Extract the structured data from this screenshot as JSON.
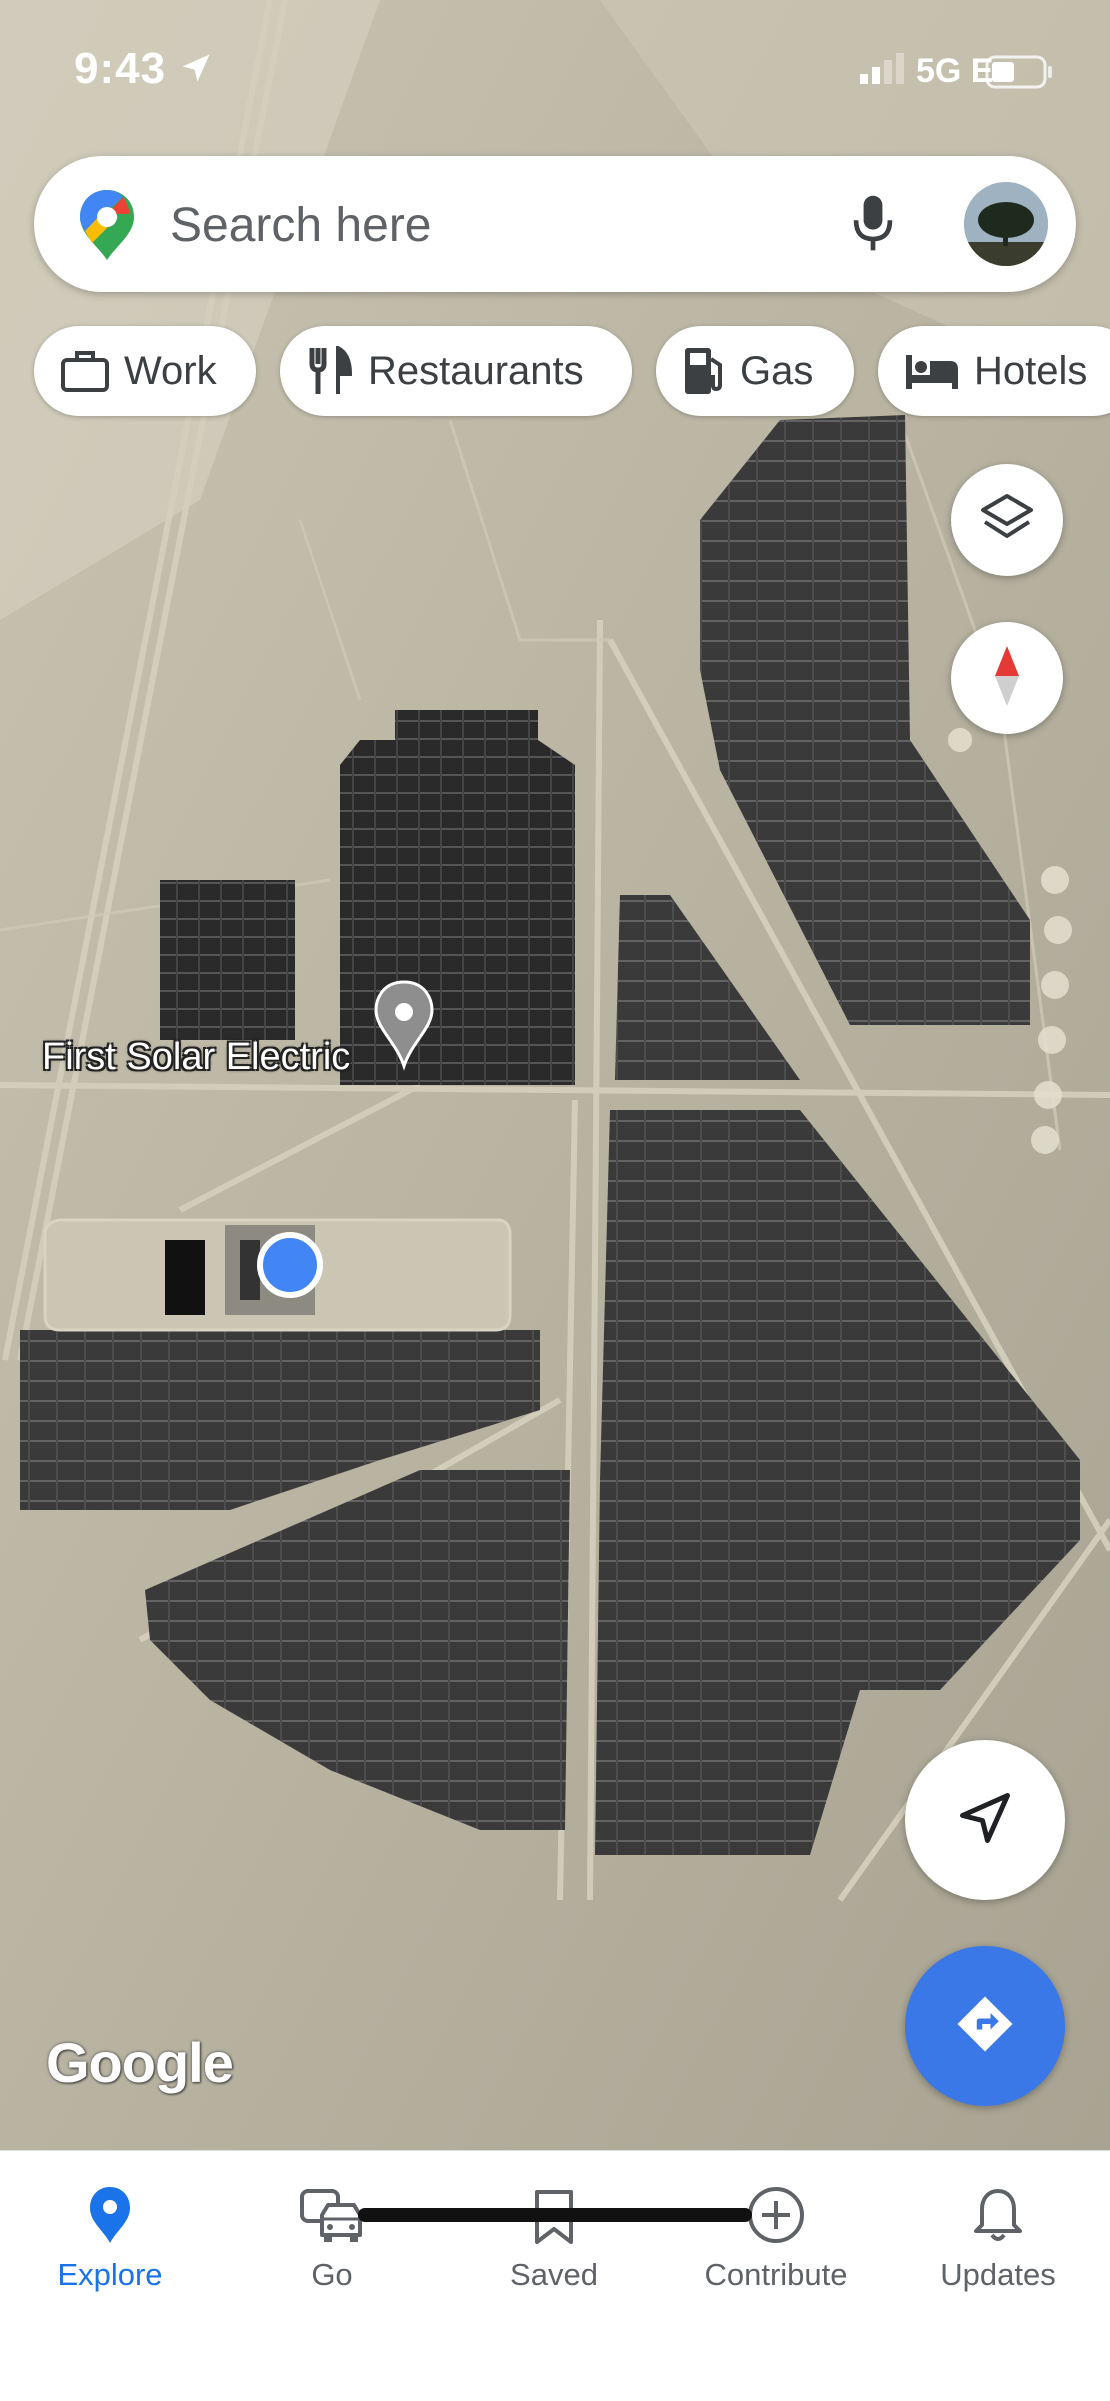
{
  "status_bar": {
    "time": "9:43",
    "network": "5G E"
  },
  "search": {
    "placeholder": "Search here"
  },
  "chips": [
    {
      "label": "Work",
      "icon": "briefcase-icon"
    },
    {
      "label": "Restaurants",
      "icon": "fork-knife-icon"
    },
    {
      "label": "Gas",
      "icon": "gas-pump-icon"
    },
    {
      "label": "Hotels",
      "icon": "bed-icon"
    }
  ],
  "map": {
    "place_label": "First Solar Electric",
    "attribution": "Google"
  },
  "bottom_nav": [
    {
      "label": "Explore",
      "icon": "pin-icon",
      "active": true
    },
    {
      "label": "Go",
      "icon": "car-icon",
      "active": false
    },
    {
      "label": "Saved",
      "icon": "bookmark-icon",
      "active": false
    },
    {
      "label": "Contribute",
      "icon": "add-circle-icon",
      "active": false
    },
    {
      "label": "Updates",
      "icon": "bell-icon",
      "active": false
    }
  ],
  "colors": {
    "accent": "#1a73e8",
    "directions_fab": "#3b78e7",
    "location_dot": "#4285f4",
    "compass_north": "#e53935"
  }
}
